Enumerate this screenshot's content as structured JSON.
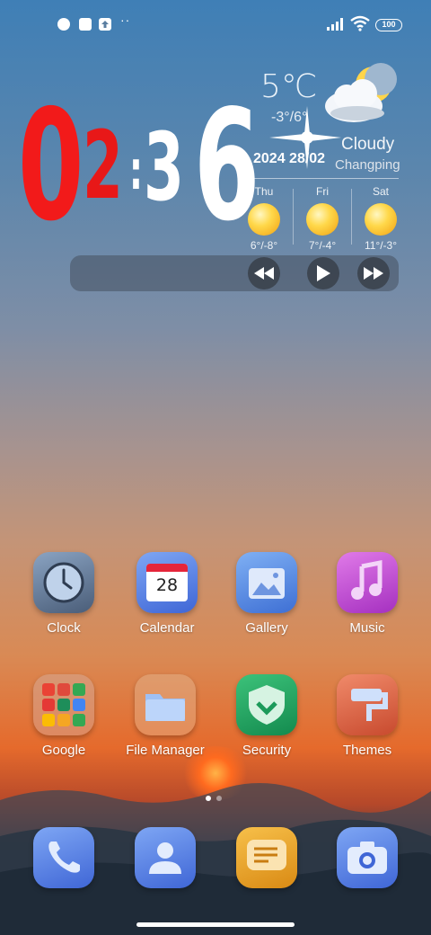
{
  "status_bar": {
    "dots": "··",
    "battery": "100",
    "icons": [
      "notification-app-icon",
      "square-icon",
      "upload-icon",
      "signal-icon",
      "wifi-icon",
      "battery-icon"
    ]
  },
  "clock": {
    "h1": "0",
    "h2": "2",
    "sep": ":",
    "m1": "3",
    "m2": "6"
  },
  "weather": {
    "temp": "5℃",
    "range": "-3°/6°",
    "condition": "Cloudy",
    "date": "2024 28/02",
    "location": "Changping",
    "forecast": [
      {
        "day": "Thu",
        "range": "6°/-8°"
      },
      {
        "day": "Fri",
        "range": "7°/-4°"
      },
      {
        "day": "Sat",
        "range": "11°/-3°"
      }
    ]
  },
  "music": {
    "buttons": [
      "rewind-icon",
      "play-icon",
      "fast-forward-icon"
    ]
  },
  "apps": [
    {
      "label": "Clock"
    },
    {
      "label": "Calendar",
      "date": "28"
    },
    {
      "label": "Gallery"
    },
    {
      "label": "Music"
    },
    {
      "label": "Google"
    },
    {
      "label": "File Manager"
    },
    {
      "label": "Security"
    },
    {
      "label": "Themes"
    }
  ],
  "dock": [
    "phone-icon",
    "contacts-icon",
    "messages-icon",
    "camera-icon"
  ],
  "page_indicator": {
    "count": 2,
    "active": 0
  }
}
